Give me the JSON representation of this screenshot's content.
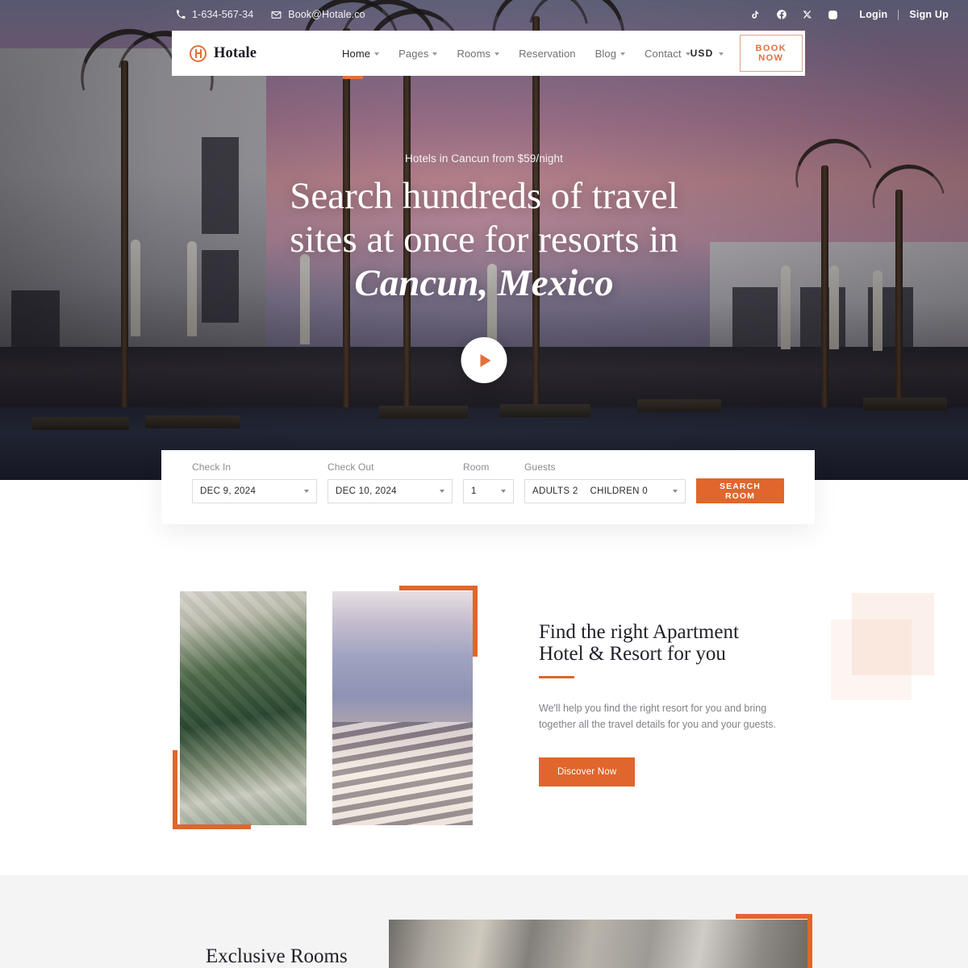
{
  "topbar": {
    "phone": "1-634-567-34",
    "email": "Book@Hotale.co",
    "socials": [
      {
        "name": "tiktok-icon",
        "label": "TikTok"
      },
      {
        "name": "facebook-icon",
        "label": "Facebook"
      },
      {
        "name": "x-twitter-icon",
        "label": "X"
      },
      {
        "name": "instagram-icon",
        "label": "Instagram"
      }
    ],
    "login": "Login",
    "signup": "Sign Up"
  },
  "navbar": {
    "brand": "Hotale",
    "links": [
      {
        "label": "Home",
        "dropdown": true,
        "active": true
      },
      {
        "label": "Pages",
        "dropdown": true,
        "active": false
      },
      {
        "label": "Rooms",
        "dropdown": true,
        "active": false
      },
      {
        "label": "Reservation",
        "dropdown": false,
        "active": false
      },
      {
        "label": "Blog",
        "dropdown": true,
        "active": false
      },
      {
        "label": "Contact",
        "dropdown": true,
        "active": false
      }
    ],
    "currency": "USD",
    "book_now": "BOOK NOW"
  },
  "hero": {
    "eyebrow": "Hotels in Cancun from $59/night",
    "title_line1": "Search hundreds of travel",
    "title_line2": "sites at once for resorts in",
    "title_line3": "Cancun, Mexico",
    "play_label": "play-video"
  },
  "search": {
    "checkin_label": "Check In",
    "checkin_value": "DEC 9, 2024",
    "checkout_label": "Check Out",
    "checkout_value": "DEC 10, 2024",
    "room_label": "Room",
    "room_value": "1",
    "guests_label": "Guests",
    "guests_adults": "ADULTS 2",
    "guests_children": "CHILDREN 0",
    "submit": "SEARCH ROOM"
  },
  "about": {
    "title_line1": "Find the right Apartment",
    "title_line2": "Hotel & Resort for you",
    "body": "We'll help you find the right resort for you and bring together all the travel details for you and your guests.",
    "cta": "Discover Now"
  },
  "rooms": {
    "title": "Exclusive Rooms"
  },
  "colors": {
    "accent": "#e0662b",
    "accent_light": "#e0703f",
    "text_dark": "#20202a",
    "text_muted": "#81818a",
    "section_bg": "#f4f4f4"
  }
}
